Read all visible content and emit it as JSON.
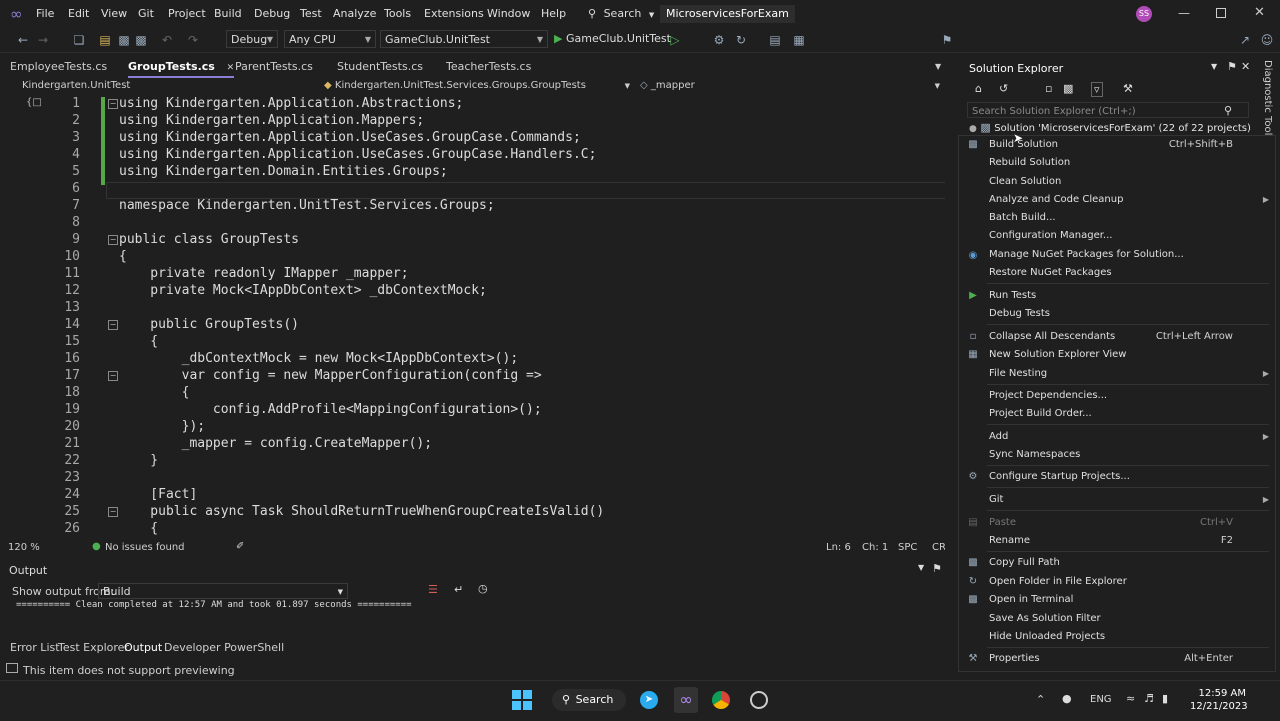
{
  "menu": {
    "items": [
      "File",
      "Edit",
      "View",
      "Git",
      "Project",
      "Build",
      "Debug",
      "Test",
      "Analyze",
      "Tools",
      "Extensions",
      "Window",
      "Help"
    ],
    "search_label": "Search",
    "solution_title": "MicroservicesForExam",
    "avatar_initials": "SS"
  },
  "toolbar": {
    "config": "Debug",
    "platform": "Any CPU",
    "startup_project": "GameClub.UnitTest",
    "run_label": "GameClub.UnitTest"
  },
  "tabs": [
    "EmployeeTests.cs",
    "GroupTests.cs",
    "ParentTests.cs",
    "StudentTests.cs",
    "TeacherTests.cs"
  ],
  "navbar": {
    "project": "Kindergarten.UnitTest",
    "class": "Kindergarten.UnitTest.Services.Groups.GroupTests",
    "member": "_mapper"
  },
  "code_lines": [
    "1",
    "2",
    "3",
    "4",
    "5",
    "6",
    "7",
    "8",
    "9",
    "10",
    "11",
    "12",
    "13",
    "14",
    "15",
    "16",
    "17",
    "18",
    "19",
    "20",
    "21",
    "22",
    "23",
    "24",
    "25",
    "26"
  ],
  "code": {
    "l1": "using Kindergarten.Application.Abstractions;",
    "l2": "using Kindergarten.Application.Mappers;",
    "l3": "using Kindergarten.Application.UseCases.GroupCase.Commands;",
    "l4": "using Kindergarten.Application.UseCases.GroupCase.Handlers.C;",
    "l5": "using Kindergarten.Domain.Entities.Groups;",
    "l7": "namespace Kindergarten.UnitTest.Services.Groups;",
    "l9": "public class GroupTests",
    "l10": "{",
    "l11": "    private readonly IMapper _mapper;",
    "l12": "    private Mock<IAppDbContext> _dbContextMock;",
    "l14": "    public GroupTests()",
    "l15": "    {",
    "l16": "        _dbContextMock = new Mock<IAppDbContext>();",
    "l17": "        var config = new MapperConfiguration(config =>",
    "l18": "        {",
    "l19": "            config.AddProfile<MappingConfiguration>();",
    "l20": "        });",
    "l21": "        _mapper = config.CreateMapper();",
    "l22": "    }",
    "l24": "    [Fact]",
    "l25": "    public async Task ShouldReturnTrueWhenGroupCreateIsValid()",
    "l26": "    {"
  },
  "editor_status": {
    "zoom": "120 %",
    "issues": "No issues found",
    "ln": "Ln: 6",
    "ch": "Ch: 1",
    "spc": "SPC",
    "crlf": "CRLF"
  },
  "output": {
    "title": "Output",
    "show_from_label": "Show output from:",
    "source": "Build",
    "text": "========== Clean completed at 12:57 AM and took 01.897 seconds =========="
  },
  "bottom_tabs": [
    "Error List",
    "Test Explorer",
    "Output",
    "Developer PowerShell"
  ],
  "status_text": "This item does not support previewing",
  "solution_explorer": {
    "title": "Solution Explorer",
    "search_placeholder": "Search Solution Explorer (Ctrl+;)",
    "root": "Solution 'MicroservicesForExam' (22 of 22 projects)",
    "side_tab": "Diagnostic Tools"
  },
  "context_menu": [
    {
      "label": "Build Solution",
      "shortcut": "Ctrl+Shift+B"
    },
    {
      "label": "Rebuild Solution",
      "shortcut": ""
    },
    {
      "label": "Clean Solution",
      "shortcut": ""
    },
    {
      "label": "Analyze and Code Cleanup",
      "shortcut": ""
    },
    {
      "label": "Batch Build...",
      "shortcut": ""
    },
    {
      "label": "Configuration Manager...",
      "shortcut": ""
    },
    {
      "label": "Manage NuGet Packages for Solution...",
      "shortcut": ""
    },
    {
      "label": "Restore NuGet Packages",
      "shortcut": ""
    },
    {
      "label": "Run Tests",
      "shortcut": ""
    },
    {
      "label": "Debug Tests",
      "shortcut": ""
    },
    {
      "label": "Collapse All Descendants",
      "shortcut": "Ctrl+Left Arrow"
    },
    {
      "label": "New Solution Explorer View",
      "shortcut": ""
    },
    {
      "label": "File Nesting",
      "shortcut": ""
    },
    {
      "label": "Project Dependencies...",
      "shortcut": ""
    },
    {
      "label": "Project Build Order...",
      "shortcut": ""
    },
    {
      "label": "Add",
      "shortcut": ""
    },
    {
      "label": "Sync Namespaces",
      "shortcut": ""
    },
    {
      "label": "Configure Startup Projects...",
      "shortcut": ""
    },
    {
      "label": "Git",
      "shortcut": ""
    },
    {
      "label": "Paste",
      "shortcut": "Ctrl+V"
    },
    {
      "label": "Rename",
      "shortcut": "F2"
    },
    {
      "label": "Copy Full Path",
      "shortcut": ""
    },
    {
      "label": "Open Folder in File Explorer",
      "shortcut": ""
    },
    {
      "label": "Open in Terminal",
      "shortcut": ""
    },
    {
      "label": "Save As Solution Filter",
      "shortcut": ""
    },
    {
      "label": "Hide Unloaded Projects",
      "shortcut": ""
    },
    {
      "label": "Properties",
      "shortcut": "Alt+Enter"
    }
  ],
  "taskbar": {
    "search_label": "Search",
    "lang": "ENG",
    "time": "12:59 AM",
    "date": "12/21/2023"
  },
  "colors": {
    "background": "#1f1f1f",
    "keyword": "#569cd6",
    "type": "#4ec9b0",
    "method": "#dcdcaa",
    "accent": "#b04cb7"
  }
}
